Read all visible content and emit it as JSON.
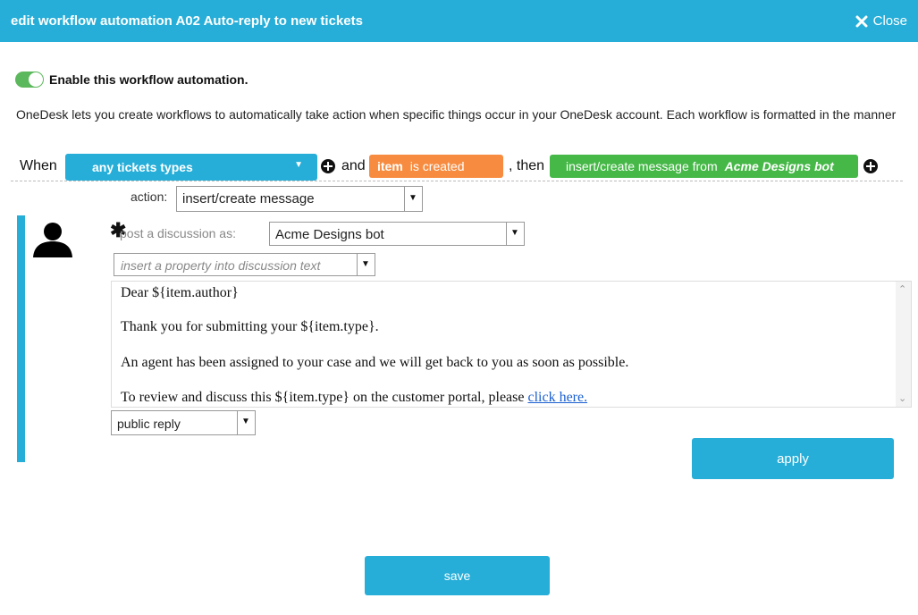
{
  "header": {
    "title": "edit workflow automation A02 Auto-reply to new tickets",
    "close_label": "Close"
  },
  "enable": {
    "label": "Enable this workflow automation.",
    "enabled": true
  },
  "description": "OneDesk lets you create workflows to automatically take action when specific things occur in your OneDesk account. Each workflow is formatted in the manner",
  "rule": {
    "when_label": "When",
    "trigger_type": "any tickets types",
    "and_label": "and",
    "event_item": "item",
    "event_action": "is created",
    "then_label": ", then",
    "action_text": "insert/create message from",
    "action_bot": "Acme Designs bot"
  },
  "action": {
    "label": "action:",
    "value": "insert/create message"
  },
  "post": {
    "label": "post a discussion as:",
    "value": "Acme Designs bot"
  },
  "property_placeholder": "insert a property into discussion text",
  "message": {
    "line1": "Dear ${item.author}",
    "line2": "Thank you for submitting your ${item.type}.",
    "line3": "An agent has been assigned to your case and we will get back to you as soon as possible.",
    "line4": "To review and discuss this ${item.type} on the customer portal, please ",
    "link": "click here."
  },
  "reply_type": "public reply",
  "apply_label": "apply",
  "save_label": "save",
  "colors": {
    "header": "#26aed8",
    "orange": "#f78c40",
    "green": "#45b847",
    "toggle": "#5cb85c"
  }
}
